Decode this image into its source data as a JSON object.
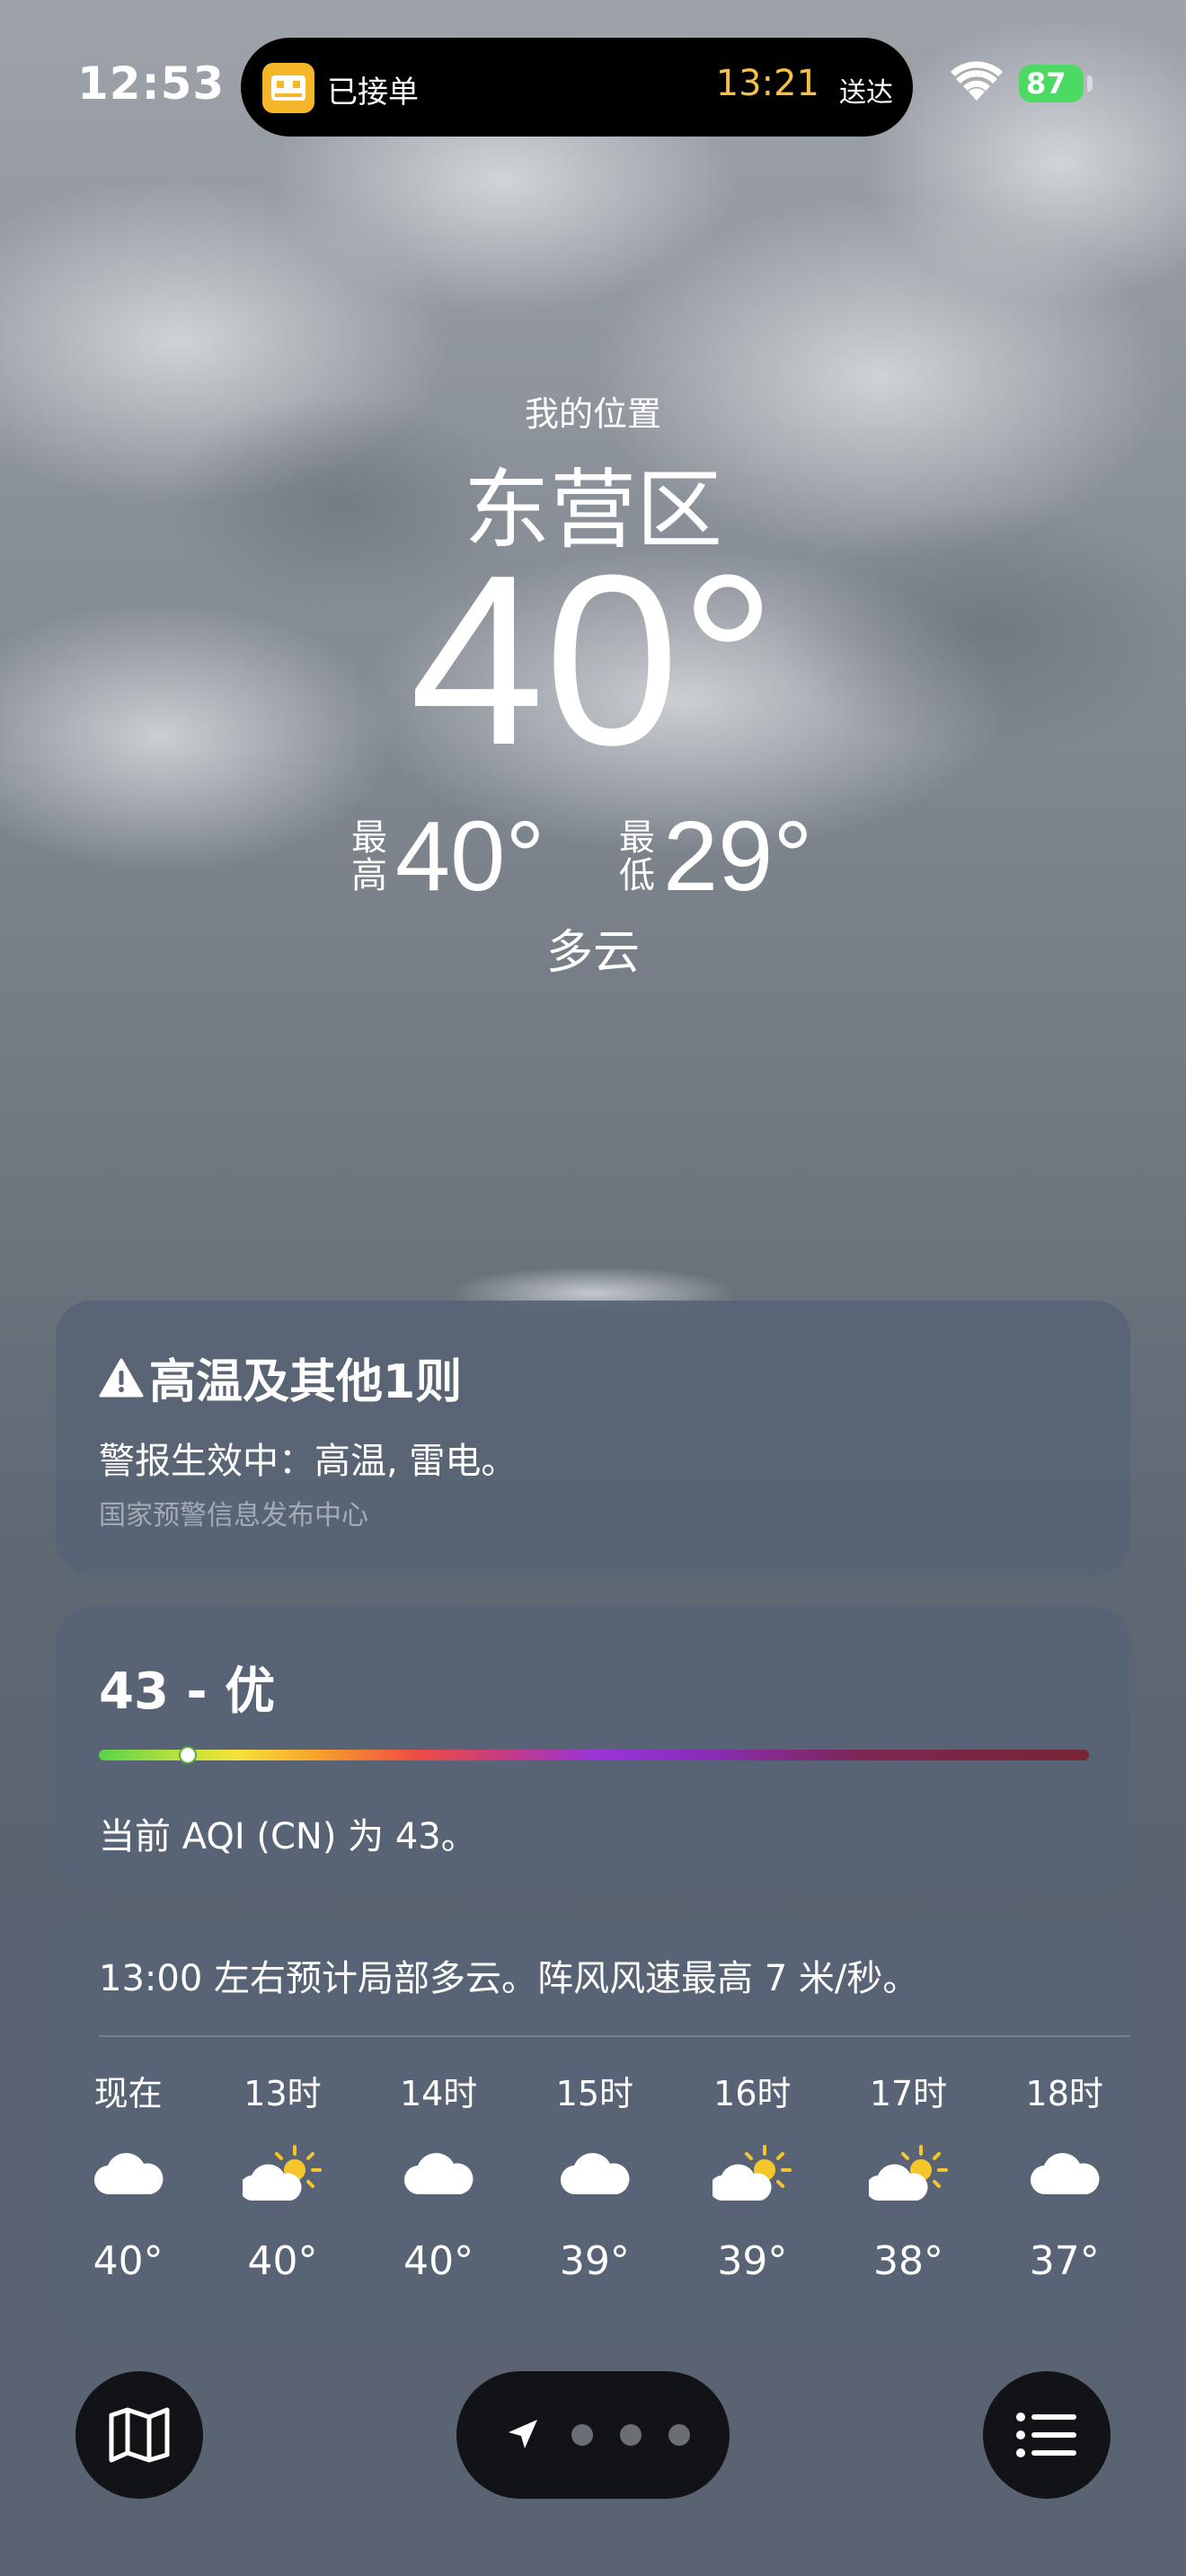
{
  "status_bar": {
    "time": "12:53",
    "live_activity": {
      "label": "已接单",
      "eta_time": "13:21",
      "eta_label": "送达"
    },
    "battery": "87",
    "battery_color": "#4cd964"
  },
  "header": {
    "location_label": "我的位置",
    "city": "东营区",
    "temperature": "40°",
    "high_label": "最高",
    "high_value": "40°",
    "low_label": "最低",
    "low_value": "29°",
    "condition": "多云"
  },
  "alert": {
    "icon": "warning-triangle-icon",
    "title": "高温及其他1则",
    "text": "警报生效中：高温, 雷电。",
    "source": "国家预警信息发布中心"
  },
  "aqi": {
    "value_label": "43 - 优",
    "value": 43,
    "scale_position": 0.09,
    "description": "当前 AQI (CN) 为 43。"
  },
  "hourly": {
    "summary": "13:00 左右预计局部多云。阵风风速最高 7 米/秒。",
    "items": [
      {
        "time": "现在",
        "icon": "cloud-icon",
        "temp": "40°"
      },
      {
        "time": "13时",
        "icon": "partly-sunny-icon",
        "temp": "40°"
      },
      {
        "time": "14时",
        "icon": "cloud-icon",
        "temp": "40°"
      },
      {
        "time": "15时",
        "icon": "cloud-icon",
        "temp": "39°"
      },
      {
        "time": "16时",
        "icon": "partly-sunny-icon",
        "temp": "39°"
      },
      {
        "time": "17时",
        "icon": "partly-sunny-icon",
        "temp": "38°"
      },
      {
        "time": "18时",
        "icon": "cloud-icon",
        "temp": "37°"
      }
    ]
  },
  "bottom_bar": {
    "map_icon": "map-icon",
    "list_icon": "list-icon",
    "location_icon": "location-arrow-icon",
    "page_dots": 3
  },
  "colors": {
    "card_bg": "#586475",
    "eta_accent": "#f7c04a",
    "sun": "#f5c52c"
  }
}
